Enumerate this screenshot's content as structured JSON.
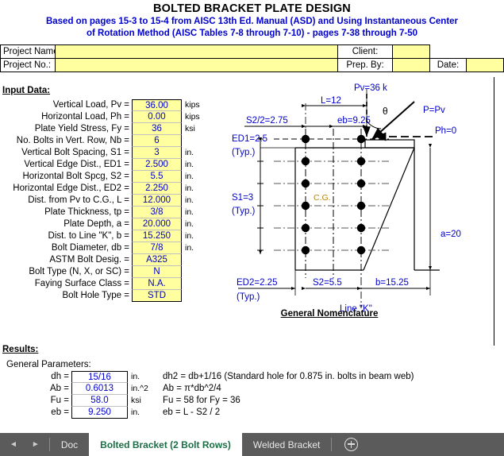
{
  "header": {
    "title": "BOLTED BRACKET PLATE DESIGN",
    "subtitle_line1": "Based on pages 15-3 to 15-4 from AISC 13th Ed. Manual (ASD) and Using Instantaneous Center",
    "subtitle_line2": "of Rotation Method (AISC Tables 7-8 through 7-10) - pages 7-38 through 7-50",
    "project_name_label": "Project Name:",
    "project_name_value": "",
    "client_label": "Client:",
    "client_value": "",
    "project_no_label": "Project No.:",
    "project_no_value": "",
    "prep_by_label": "Prep. By:",
    "prep_by_value": "",
    "date_label": "Date:",
    "date_value": ""
  },
  "input": {
    "heading": "Input Data:",
    "rows": [
      {
        "label": "Vertical Load, Pv =",
        "value": "36.00",
        "unit": "kips"
      },
      {
        "label": "Horizontal Load, Ph =",
        "value": "0.00",
        "unit": "kips"
      },
      {
        "label": "Plate Yield Stress, Fy =",
        "value": "36",
        "unit": "ksi"
      },
      {
        "label": "No. Bolts in Vert. Row, Nb =",
        "value": "6",
        "unit": ""
      },
      {
        "label": "Vertical Bolt Spacing, S1 =",
        "value": "3",
        "unit": "in."
      },
      {
        "label": "Vertical Edge Dist., ED1 =",
        "value": "2.500",
        "unit": "in."
      },
      {
        "label": "Horizontal Bolt Spcg, S2 =",
        "value": "5.5",
        "unit": "in."
      },
      {
        "label": "Horizontal Edge Dist., ED2 =",
        "value": "2.250",
        "unit": "in."
      },
      {
        "label": "Dist. from Pv to C.G., L =",
        "value": "12.000",
        "unit": "in."
      },
      {
        "label": "Plate Thickness, tp =",
        "value": "3/8",
        "unit": "in."
      },
      {
        "label": "Plate Depth, a =",
        "value": "20.000",
        "unit": "in."
      },
      {
        "label": "Dist. to Line \"K\", b =",
        "value": "15.250",
        "unit": "in."
      },
      {
        "label": "Bolt Diameter, db =",
        "value": "7/8",
        "unit": "in."
      },
      {
        "label": "ASTM Bolt Desig. =",
        "value": "A325",
        "unit": ""
      },
      {
        "label": "Bolt Type (N, X, or SC) =",
        "value": "N",
        "unit": ""
      },
      {
        "label": "Faying Surface Class =",
        "value": "N.A.",
        "unit": ""
      },
      {
        "label": "Bolt Hole Type =",
        "value": "STD",
        "unit": ""
      }
    ]
  },
  "results": {
    "heading": "Results:",
    "subheading": "General Parameters:",
    "rows": [
      {
        "label": "dh =",
        "value": "15/16",
        "unit": "in.",
        "note": "dh2 = db+1/16 (Standard hole for 0.875 in. bolts in beam web)"
      },
      {
        "label": "Ab =",
        "value": "0.6013",
        "unit": "in.^2",
        "note": "Ab = π*db^2/4"
      },
      {
        "label": "Fu =",
        "value": "58.0",
        "unit": "ksi",
        "note": "Fu = 58 for Fy = 36"
      },
      {
        "label": "eb =",
        "value": "9.250",
        "unit": "in.",
        "note": "eb = L - S2 / 2"
      }
    ]
  },
  "diagram": {
    "caption": "General Nomenclature",
    "labels": {
      "pv": "Pv=36 k",
      "p_eq_pv": "P=Pv",
      "theta": "θ",
      "ph": "Ph=0",
      "L": "L=12",
      "s2_half": "S2/2=2.75",
      "eb": "eb=9.25",
      "ed1": "ED1=2.5",
      "ed1_typ": "(Typ.)",
      "s1": "S1=3",
      "s1_typ": "(Typ.)",
      "cg": "C.G.",
      "a": "a=20",
      "ed2": "ED2=2.25",
      "ed2_typ": "(Typ.)",
      "s2": "S2=5.5",
      "b": "b=15.25",
      "line_k": "Line \"K\""
    },
    "bolt_rows": 6,
    "bolt_columns": 2,
    "accent_color": "#0000cd"
  },
  "tabbar": {
    "prev_arrow": "◄",
    "next_arrow": "►",
    "tabs": [
      {
        "label": "Doc",
        "active": false
      },
      {
        "label": "Bolted Bracket (2 Bolt Rows)",
        "active": true
      },
      {
        "label": "Welded Bracket",
        "active": false
      }
    ],
    "add_sheet": "+"
  }
}
